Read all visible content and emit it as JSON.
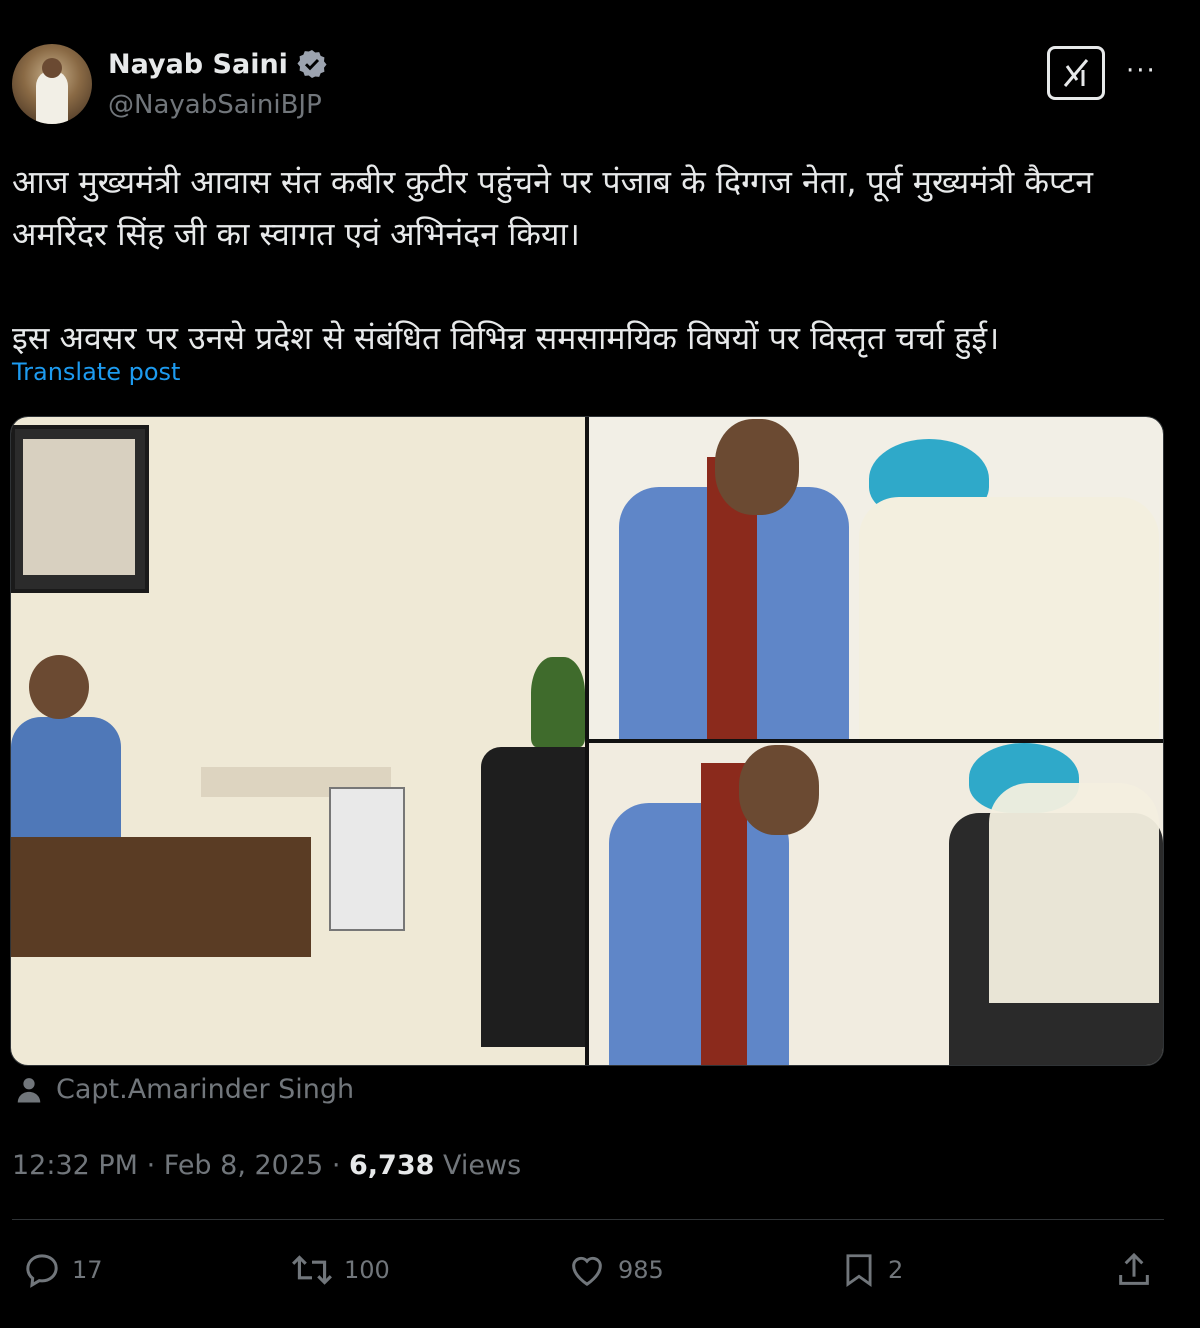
{
  "author": {
    "name": "Nayab Saini",
    "handle": "@NayabSainiBJP"
  },
  "post": {
    "para1": "आज मुख्यमंत्री आवास संत कबीर कुटीर पहुंचने पर पंजाब के दिग्गज नेता, पूर्व मुख्यमंत्री कैप्टन अमरिंदर सिंह जी का स्वागत एवं अभिनंदन किया।",
    "para2": "इस अवसर पर उनसे प्रदेश से संबंधित विभिन्न समसामयिक विषयों पर विस्तृत चर्चा हुई।",
    "translate_label": "Translate post"
  },
  "tagged_user": "Capt.Amarinder Singh",
  "meta": {
    "time": "12:32 PM",
    "date": "Feb 8, 2025",
    "views_count": "6,738",
    "views_label": "Views",
    "separator": "·"
  },
  "actions": {
    "replies": "17",
    "reposts": "100",
    "likes": "985",
    "bookmarks": "2"
  },
  "icons": {
    "verified": "verified-badge-icon",
    "grok": "grok-icon",
    "more": "more-icon",
    "person": "person-icon",
    "reply": "reply-icon",
    "repost": "repost-icon",
    "like": "heart-icon",
    "bookmark": "bookmark-icon",
    "share": "share-icon"
  },
  "colors": {
    "background": "#000000",
    "text": "#e7e9ea",
    "muted": "#71767b",
    "link": "#1d9bf0"
  }
}
